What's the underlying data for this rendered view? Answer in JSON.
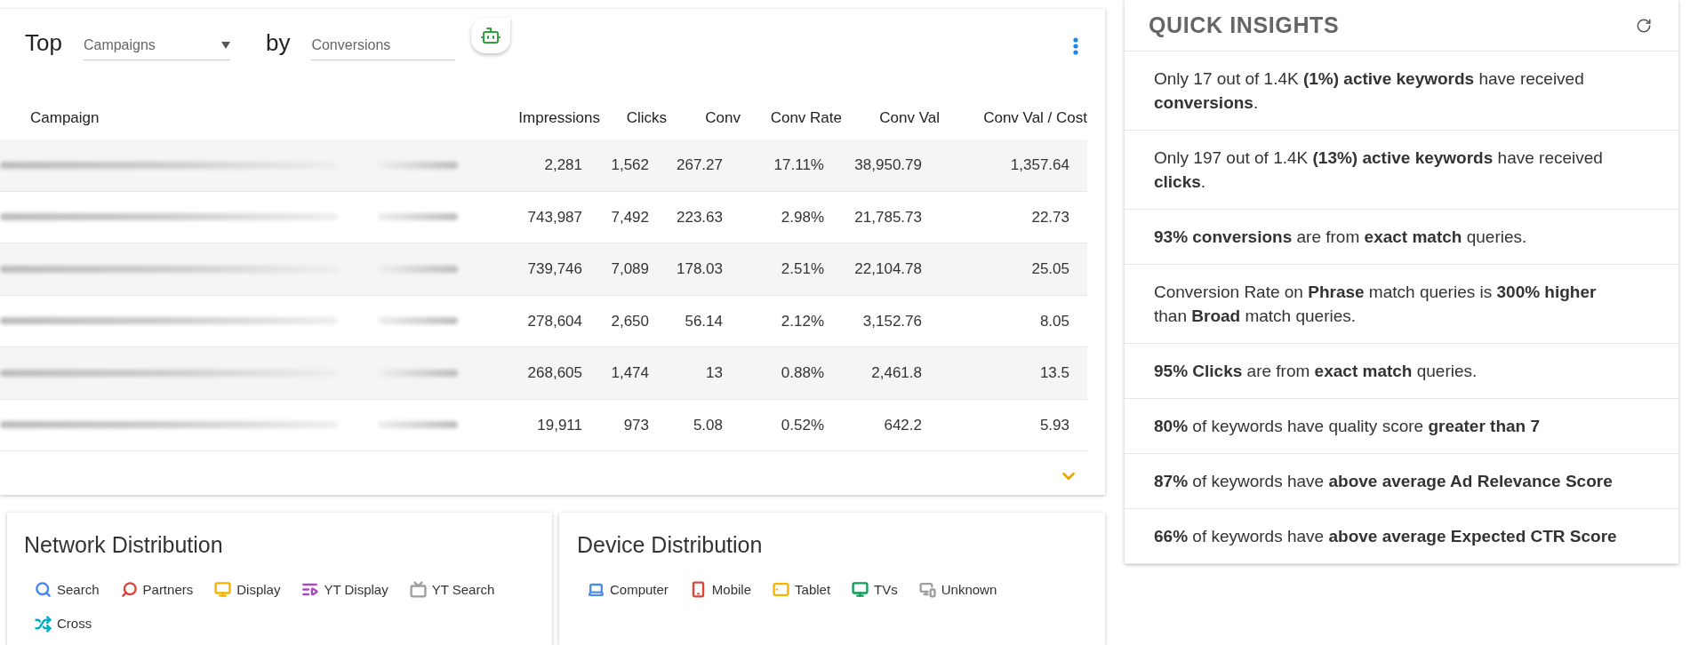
{
  "top_card": {
    "prefix": "Top",
    "dimension": "Campaigns",
    "joiner": "by",
    "metric": "Conversions"
  },
  "table": {
    "columns": [
      "Campaign",
      "Impressions",
      "Clicks",
      "Conv",
      "Conv Rate",
      "Conv Val",
      "Conv Val / Cost"
    ],
    "rows": [
      {
        "cells": [
          "",
          "2,281",
          "1,562",
          "267.27",
          "17.11%",
          "38,950.79",
          "1,357.64"
        ]
      },
      {
        "cells": [
          "",
          "743,987",
          "7,492",
          "223.63",
          "2.98%",
          "21,785.73",
          "22.73"
        ]
      },
      {
        "cells": [
          "",
          "739,746",
          "7,089",
          "178.03",
          "2.51%",
          "22,104.78",
          "25.05"
        ]
      },
      {
        "cells": [
          "",
          "278,604",
          "2,650",
          "56.14",
          "2.12%",
          "3,152.76",
          "8.05"
        ]
      },
      {
        "cells": [
          "",
          "268,605",
          "1,474",
          "13",
          "0.88%",
          "2,461.8",
          "13.5"
        ]
      },
      {
        "cells": [
          "",
          "19,911",
          "973",
          "5.08",
          "0.52%",
          "642.2",
          "5.93"
        ]
      }
    ]
  },
  "network_distribution": {
    "title": "Network Distribution",
    "legend": [
      {
        "label": "Search",
        "color": "#4285f4"
      },
      {
        "label": "Partners",
        "color": "#db4437"
      },
      {
        "label": "Display",
        "color": "#f4b400"
      },
      {
        "label": "YT Display",
        "color": "#ab47bc"
      },
      {
        "label": "YT Search",
        "color": "#9e9e9e"
      },
      {
        "label": "Cross",
        "color": "#00acc1"
      }
    ]
  },
  "device_distribution": {
    "title": "Device Distribution",
    "legend": [
      {
        "label": "Computer",
        "color": "#4a90e2"
      },
      {
        "label": "Mobile",
        "color": "#db4437"
      },
      {
        "label": "Tablet",
        "color": "#f4b400"
      },
      {
        "label": "TVs",
        "color": "#0f9d58"
      },
      {
        "label": "Unknown",
        "color": "#9e9e9e"
      }
    ]
  },
  "quick_insights": {
    "title": "QUICK INSIGHTS",
    "items": [
      "Only 17 out of 1.4K **(1%)** **active keywords** have received **conversions**.",
      "Only 197 out of 1.4K **(13%)** **active keywords** have received **clicks**.",
      "**93% conversions** are from **exact match** queries.",
      "Conversion Rate on **Phrase** match queries is **300% higher** than **Broad** match queries.",
      "**95% Clicks** are from **exact match** queries.",
      "**80%** of keywords have quality score **greater than 7**",
      "**87%** of keywords have **above average Ad Relevance Score**",
      "**66%** of keywords have **above average Expected CTR Score**"
    ]
  }
}
